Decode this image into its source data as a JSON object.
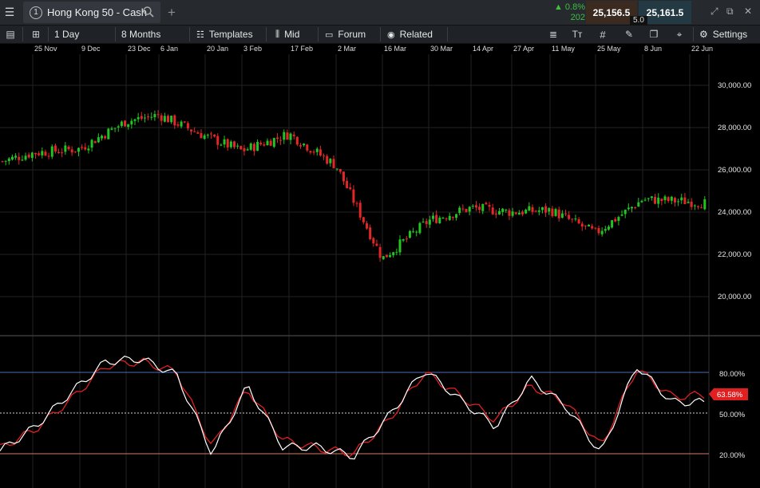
{
  "header": {
    "tab_number": "1",
    "tab_title": "Hong Kong 50 - Cash",
    "change_pct": "0.8%",
    "change_points": "202",
    "sell_price": "25,156.5",
    "buy_price": "25,161.5",
    "spread": "5.0"
  },
  "toolbar": {
    "interval": "1 Day",
    "range": "8 Months",
    "templates": "Templates",
    "price_type": "Mid",
    "forum": "Forum",
    "related": "Related",
    "settings": "Settings"
  },
  "date_axis": [
    "25 Nov",
    "9 Dec",
    "23 Dec",
    "6 Jan",
    "20 Jan",
    "3 Feb",
    "17 Feb",
    "2 Mar",
    "16 Mar",
    "30 Mar",
    "14 Apr",
    "27 Apr",
    "11 May",
    "25 May",
    "8 Jun",
    "22 Jun"
  ],
  "price_axis": [
    "30,000.00",
    "28,000.00",
    "26,000.00",
    "24,000.00",
    "22,000.00",
    "20,000.00"
  ],
  "oscillator_axis": [
    "80.00%",
    "50.00%",
    "20.00%"
  ],
  "oscillator_value": "63.58%",
  "colors": {
    "up_candle": "#22c322",
    "down_candle": "#e32626",
    "oscillator_fast": "#ffffff",
    "oscillator_slow": "#e02020",
    "level_80": "#4a6fb8",
    "level_20": "#d97a6a"
  },
  "chart_data": [
    {
      "type": "candlestick",
      "ylim": [
        18500,
        31500
      ],
      "x": [
        "25 Nov",
        "9 Dec",
        "23 Dec",
        "6 Jan",
        "20 Jan",
        "3 Feb",
        "17 Feb",
        "2 Mar",
        "16 Mar",
        "30 Mar",
        "14 Apr",
        "27 Apr",
        "11 May",
        "25 May",
        "8 Jun",
        "22 Jun"
      ],
      "y": [
        26800,
        27000,
        28300,
        28600,
        27600,
        26900,
        27700,
        26200,
        21800,
        23600,
        24200,
        24000,
        24100,
        23000,
        24600,
        24500
      ],
      "last": 24400
    },
    {
      "type": "line",
      "ylim": [
        0,
        100
      ],
      "levels": [
        80,
        50,
        20
      ],
      "series": [
        {
          "values": [
            22,
            40,
            65,
            88,
            90,
            78,
            20,
            70,
            25,
            25,
            18,
            48,
            82,
            60,
            40,
            75,
            55,
            20,
            85,
            58,
            58
          ]
        },
        {
          "values": [
            24,
            38,
            60,
            85,
            88,
            80,
            25,
            68,
            30,
            24,
            20,
            45,
            80,
            63,
            45,
            70,
            58,
            25,
            83,
            62,
            63.58
          ]
        }
      ]
    }
  ]
}
